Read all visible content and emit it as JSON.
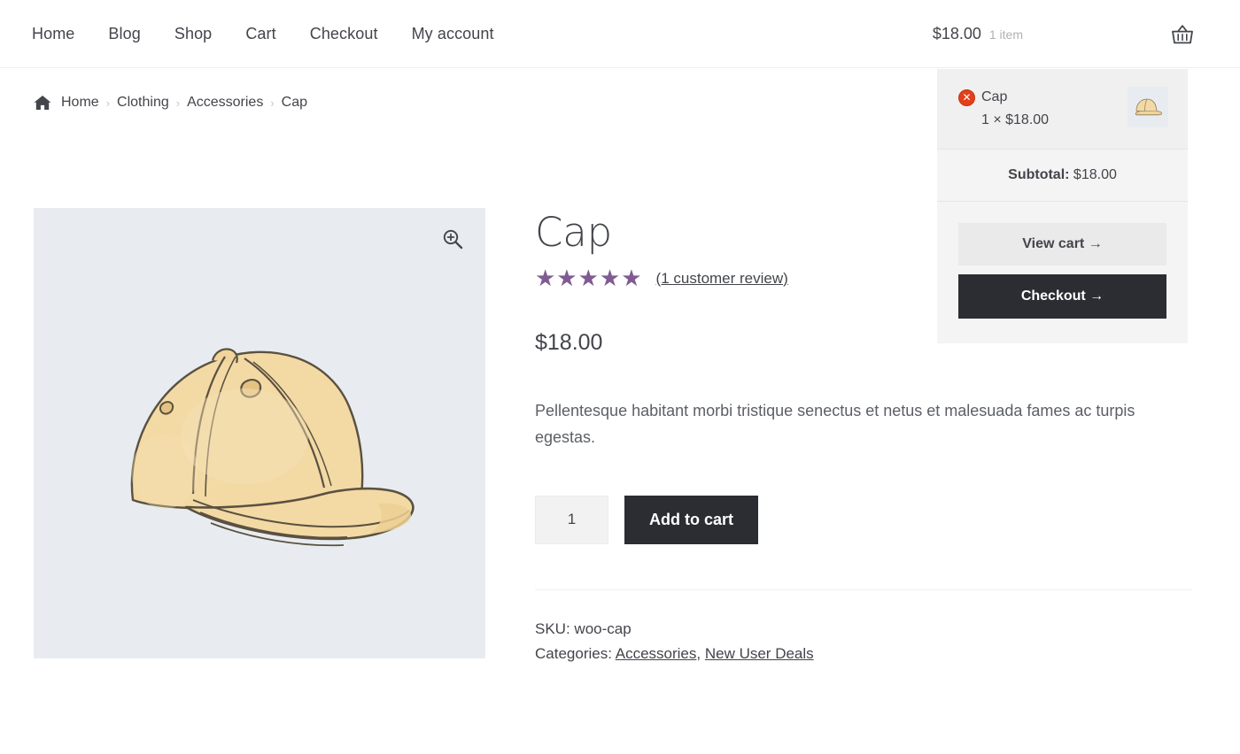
{
  "header": {
    "nav": [
      {
        "label": "Home",
        "name": "nav-item-home"
      },
      {
        "label": "Blog",
        "name": "nav-item-blog"
      },
      {
        "label": "Shop",
        "name": "nav-item-shop"
      },
      {
        "label": "Cart",
        "name": "nav-item-cart"
      },
      {
        "label": "Checkout",
        "name": "nav-item-checkout"
      },
      {
        "label": "My account",
        "name": "nav-item-my-account"
      }
    ],
    "cart_amount": "$18.00",
    "cart_count": "1 item",
    "cart_icon": "shopping-basket-icon"
  },
  "mini_cart": {
    "remove_label": "✕",
    "item_name": "Cap",
    "item_qty_price": "1 × $18.00",
    "thumbnail_alt": "cap-thumbnail",
    "subtotal_label": "Subtotal:",
    "subtotal_value": "$18.00",
    "view_cart_label": "View cart  →",
    "checkout_label": "Checkout  →"
  },
  "breadcrumb": {
    "home_icon": "home-icon",
    "items": [
      {
        "label": "Home"
      },
      {
        "label": "Clothing"
      },
      {
        "label": "Accessories"
      },
      {
        "label": "Cap"
      }
    ],
    "separator": "›"
  },
  "product": {
    "image_alt": "cap-product-image",
    "zoom_icon": "zoom-in-icon",
    "title": "Cap",
    "stars": "★★★★★",
    "rating_value": 5,
    "review_link": "(1 customer review)",
    "price": "$18.00",
    "description": "Pellentesque habitant morbi tristique senectus et netus et malesuada fames ac turpis egestas.",
    "quantity": "1",
    "add_to_cart_label": "Add to cart",
    "sku_label": "SKU:",
    "sku_value": "woo-cap",
    "categories_label": "Categories:",
    "categories": [
      {
        "label": "Accessories"
      },
      {
        "label": "New User Deals"
      }
    ]
  },
  "colors": {
    "accent_dark": "#2c2d33",
    "star": "#7f5b92",
    "remove": "#e2401c",
    "image_bg": "#e8ecf0",
    "panel_bg": "#f4f4f4",
    "text": "#43454b"
  }
}
